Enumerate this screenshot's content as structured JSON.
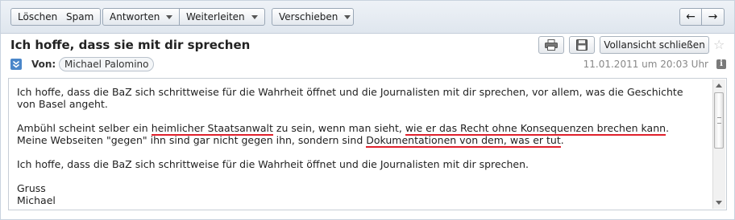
{
  "toolbar": {
    "delete_label": "Löschen",
    "spam_label": "Spam",
    "reply_label": "Antworten",
    "forward_label": "Weiterleiten",
    "move_label": "Verschieben"
  },
  "message": {
    "subject": "Ich hoffe, dass sie mit dir sprechen",
    "fullview_label": "Vollansicht schließen",
    "from_label": "Von:",
    "sender": "Michael Palomino",
    "date": "11.01.2011 um 20:03 Uhr",
    "body": {
      "p1": "Ich hoffe, dass die BaZ sich schrittweise für die Wahrheit öffnet und die Journalisten mit dir sprechen, vor allem, was die Geschichte von Basel angeht.",
      "p2_a": "Ambühl scheint selber ein ",
      "p2_u1": "heimlicher Staatsanwalt",
      "p2_b": " zu sein, wenn man sieht, ",
      "p2_u2": "wie er das Recht ohne Konsequenzen brechen kann",
      "p2_c": ".",
      "p2_d": "Meine Webseiten \"gegen\" ihn sind gar nicht gegen ihn, sondern sind ",
      "p2_u3": "Dokumentationen von dem, was er tut",
      "p2_e": ".",
      "p3": "Ich hoffe, dass die BaZ sich schrittweise für die Wahrheit öffnet und die Journalisten mit dir sprechen.",
      "sign1": "Gruss",
      "sign2": "Michael"
    }
  },
  "colors": {
    "accent": "#4a86c9",
    "underline": "#e0202c"
  }
}
